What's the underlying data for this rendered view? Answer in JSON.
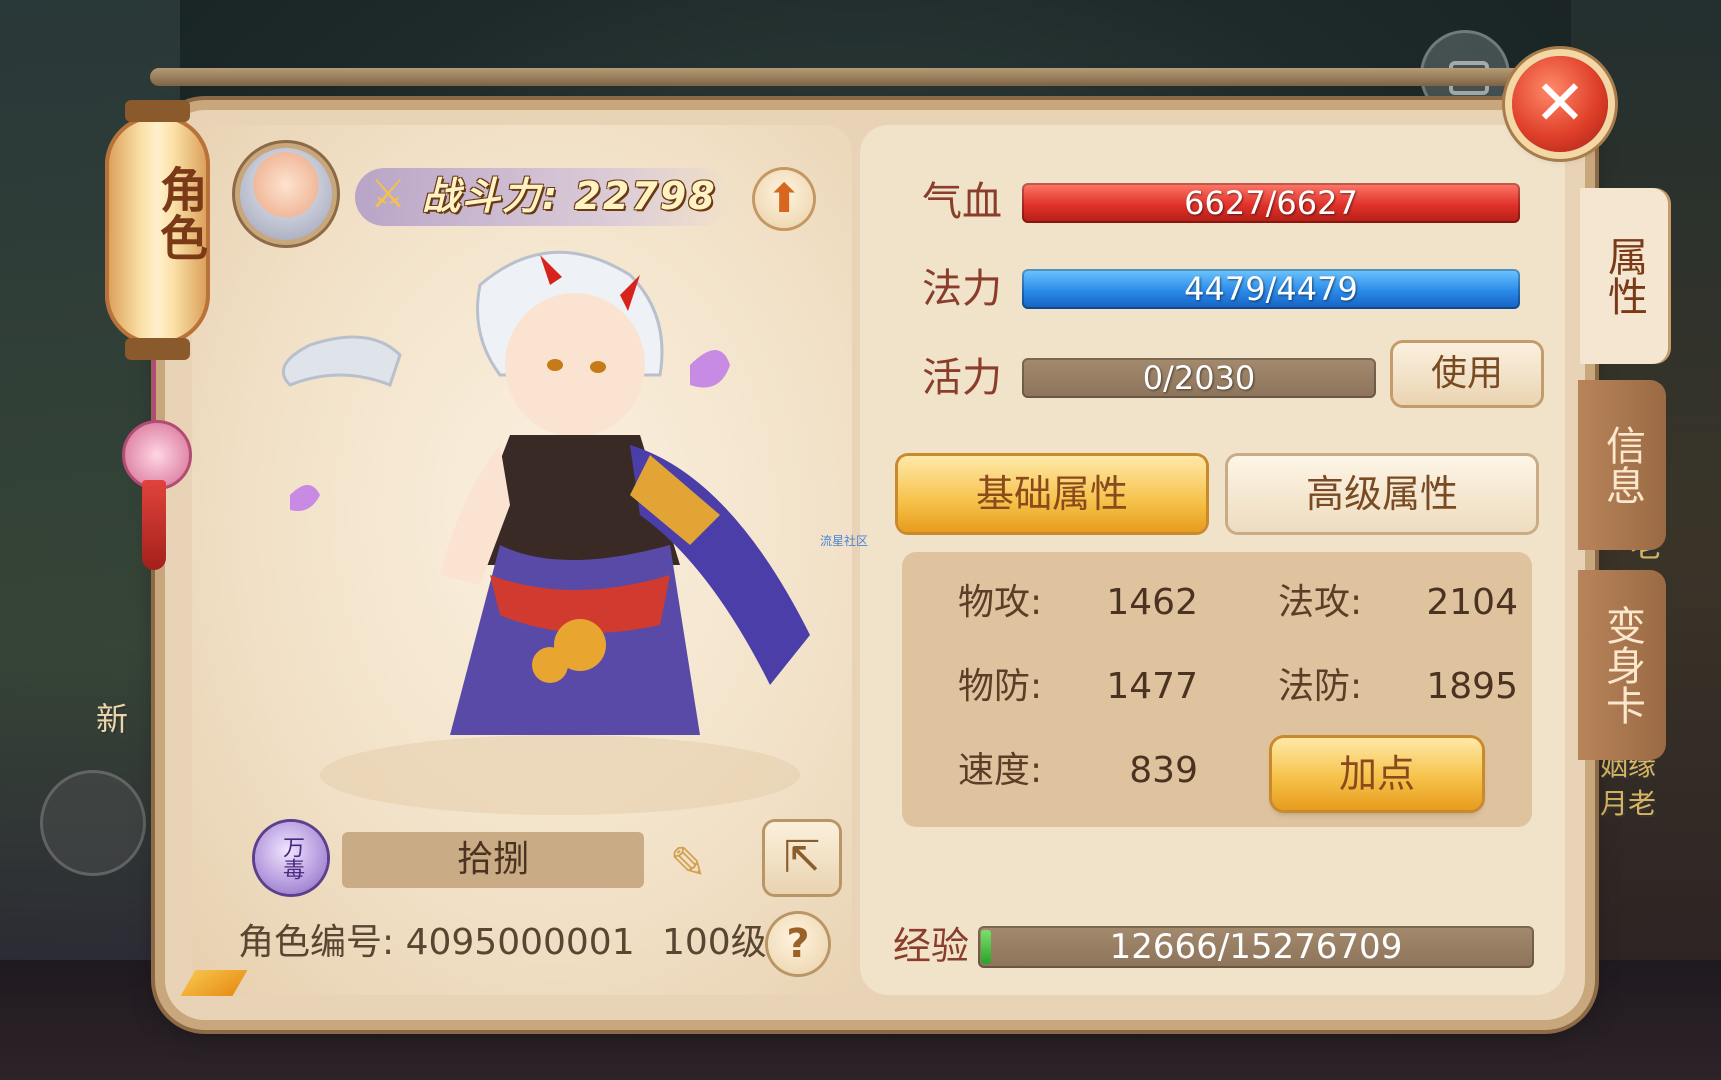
{
  "window": {
    "title": "角色"
  },
  "header": {
    "power_label": "战斗力: 22798",
    "upgrade_icon": "up-arrow-icon"
  },
  "side_tabs": [
    {
      "label": "属性",
      "active": true
    },
    {
      "label": "信息",
      "active": false
    },
    {
      "label": "变身卡",
      "active": false
    }
  ],
  "resources": {
    "hp": {
      "label": "气血",
      "value": "6627/6627",
      "fill": 1.0
    },
    "mp": {
      "label": "法力",
      "value": "4479/4479",
      "fill": 1.0
    },
    "vitality": {
      "label": "活力",
      "value": "0/2030",
      "fill": 0.0,
      "use_label": "使用"
    }
  },
  "attr_tabs": {
    "basic": "基础属性",
    "advanced": "高级属性",
    "active": "basic"
  },
  "stats": {
    "phys_atk": {
      "label": "物攻:",
      "value": "1462"
    },
    "mag_atk": {
      "label": "法攻:",
      "value": "2104"
    },
    "phys_def": {
      "label": "物防:",
      "value": "1477"
    },
    "mag_def": {
      "label": "法防:",
      "value": "1895"
    },
    "speed": {
      "label": "速度:",
      "value": "839"
    },
    "add_point_label": "加点"
  },
  "character": {
    "sect_badge": "万毒",
    "name": "拾捌",
    "role_id_label": "角色编号: 4095000001",
    "level": "100级",
    "help_label": "?"
  },
  "exp": {
    "label": "经验",
    "value": "12666/15276709",
    "fill": 0.0008
  },
  "background": {
    "new_label": "新",
    "right_labels": [
      "老",
      "姻缘",
      "月老"
    ]
  },
  "watermark": "流星社区",
  "colors": {
    "hp": "#e0322a",
    "mp": "#2a8ae8",
    "accent_gold": "#f6c24a",
    "panel": "#e8d3b6",
    "close": "#e0402a"
  }
}
